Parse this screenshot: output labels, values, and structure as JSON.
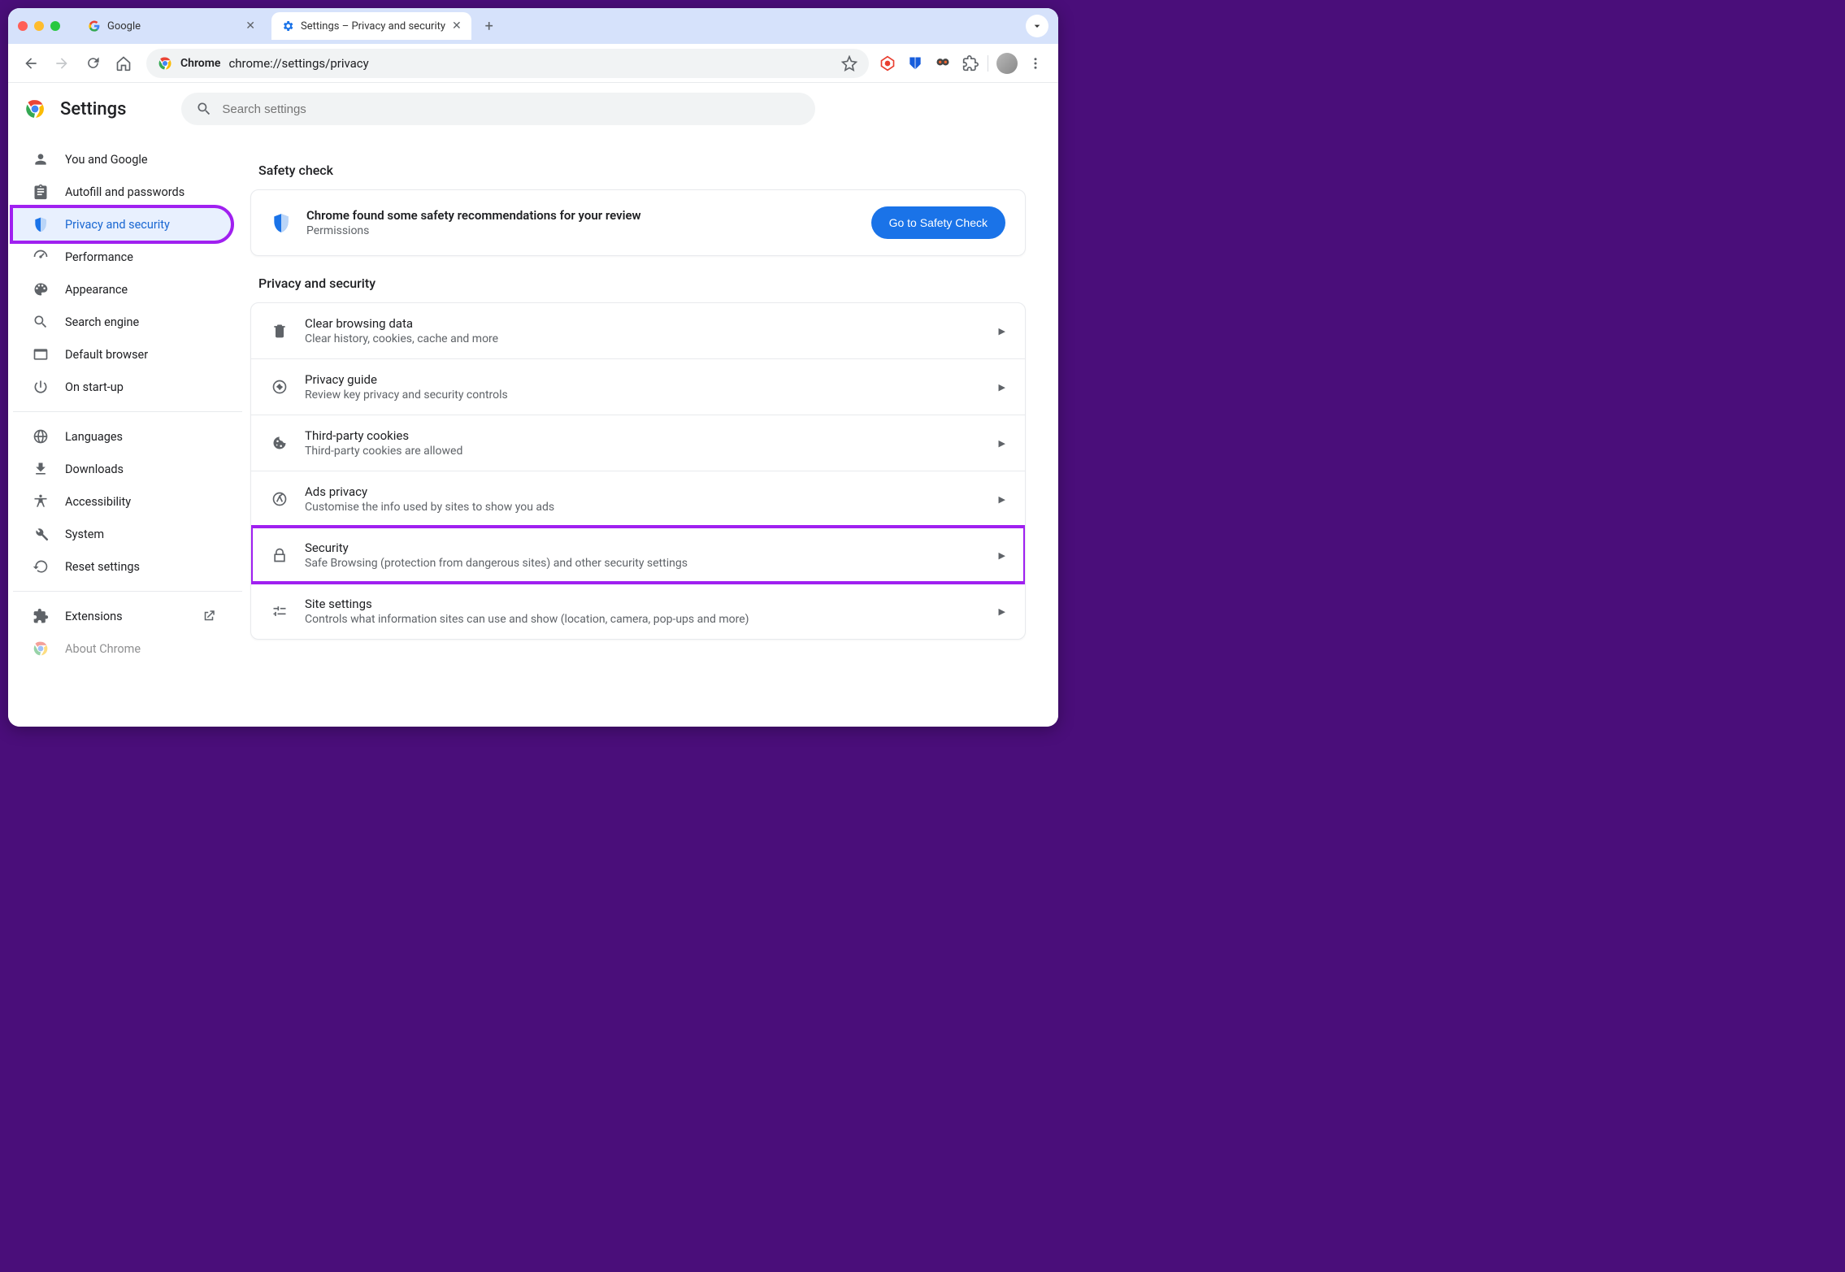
{
  "window": {
    "tabs": [
      {
        "title": "Google",
        "favicon": "google"
      },
      {
        "title": "Settings – Privacy and security",
        "favicon": "settings-gear",
        "active": true
      }
    ]
  },
  "toolbar": {
    "site_label": "Chrome",
    "url": "chrome://settings/privacy"
  },
  "settings_header": {
    "title": "Settings",
    "search_placeholder": "Search settings"
  },
  "sidebar": {
    "items": [
      {
        "label": "You and Google",
        "icon": "person"
      },
      {
        "label": "Autofill and passwords",
        "icon": "clipboard"
      },
      {
        "label": "Privacy and security",
        "icon": "shield",
        "active": true,
        "highlighted": true
      },
      {
        "label": "Performance",
        "icon": "speedometer"
      },
      {
        "label": "Appearance",
        "icon": "palette"
      },
      {
        "label": "Search engine",
        "icon": "search"
      },
      {
        "label": "Default browser",
        "icon": "browser"
      },
      {
        "label": "On start-up",
        "icon": "power"
      }
    ],
    "items2": [
      {
        "label": "Languages",
        "icon": "globe"
      },
      {
        "label": "Downloads",
        "icon": "download"
      },
      {
        "label": "Accessibility",
        "icon": "accessibility"
      },
      {
        "label": "System",
        "icon": "wrench"
      },
      {
        "label": "Reset settings",
        "icon": "reset"
      }
    ],
    "items3": [
      {
        "label": "Extensions",
        "icon": "puzzle",
        "external": true
      },
      {
        "label": "About Chrome",
        "icon": "chrome-logo"
      }
    ]
  },
  "main": {
    "safety_check": {
      "section_title": "Safety check",
      "title": "Chrome found some safety recommendations for your review",
      "subtitle": "Permissions",
      "button": "Go to Safety Check"
    },
    "privacy": {
      "section_title": "Privacy and security",
      "rows": [
        {
          "icon": "trash",
          "title": "Clear browsing data",
          "sub": "Clear history, cookies, cache and more"
        },
        {
          "icon": "compass",
          "title": "Privacy guide",
          "sub": "Review key privacy and security controls"
        },
        {
          "icon": "cookie",
          "title": "Third-party cookies",
          "sub": "Third-party cookies are allowed"
        },
        {
          "icon": "ads",
          "title": "Ads privacy",
          "sub": "Customise the info used by sites to show you ads"
        },
        {
          "icon": "lock",
          "title": "Security",
          "sub": "Safe Browsing (protection from dangerous sites) and other security settings",
          "highlighted": true
        },
        {
          "icon": "sliders",
          "title": "Site settings",
          "sub": "Controls what information sites can use and show (location, camera, pop-ups and more)"
        }
      ]
    }
  }
}
